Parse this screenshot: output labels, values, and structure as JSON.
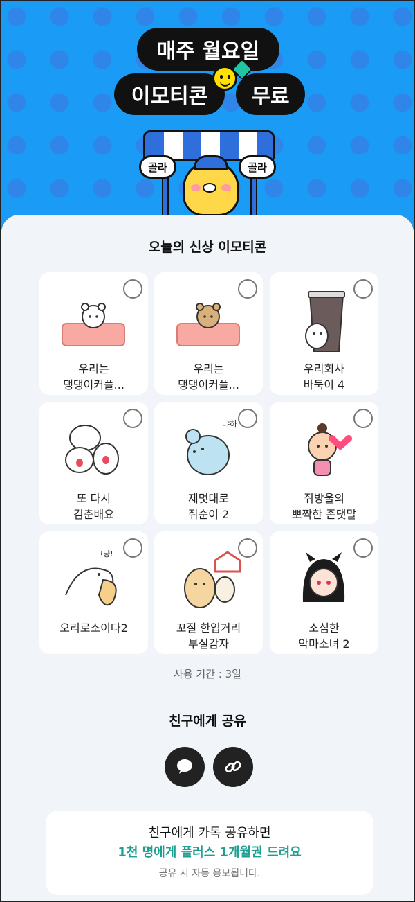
{
  "hero": {
    "line1": "매주 월요일",
    "line2_left": "이모티콘",
    "line2_right": "무료",
    "sign_left": "골라",
    "sign_right": "골라"
  },
  "section_title": "오늘의 신상 이모티콘",
  "emoticons": [
    {
      "label": "우리는\n댕댕이커플...",
      "icon": "white-hamster-sticker"
    },
    {
      "label": "우리는\n댕댕이커플...",
      "icon": "brown-hamster-sticker"
    },
    {
      "label": "우리회사\n바둑이 4",
      "icon": "coffee-cup-dog-sticker"
    },
    {
      "label": "또 다시\n김춘배요",
      "icon": "white-cats-sticker"
    },
    {
      "label": "제멋대로\n쥐순이 2",
      "icon": "blue-mouse-sticker"
    },
    {
      "label": "쥐방울의\n뽀짝한 존댓말",
      "icon": "baby-heart-sticker"
    },
    {
      "label": "오리로소이다2",
      "icon": "duck-sticker"
    },
    {
      "label": "꼬질 한입거리\n부실감자",
      "icon": "potato-friends-sticker"
    },
    {
      "label": "소심한\n악마소녀 2",
      "icon": "devil-girl-sticker"
    }
  ],
  "usage_period": "사용 기간 : 3일",
  "share": {
    "title": "친구에게 공유",
    "kakao_icon": "chat-bubble-icon",
    "link_icon": "link-icon"
  },
  "promo": {
    "line1": "친구에게 카톡 공유하면",
    "line2": "1천 명에게 플러스 1개월권 드려요",
    "line3": "공유 시 자동 응모됩니다."
  },
  "colors": {
    "hero_bg": "#1a9bf6",
    "accent_teal": "#1e9f92",
    "pill_bg": "#111111",
    "sheet_bg": "#f1f5f9"
  }
}
